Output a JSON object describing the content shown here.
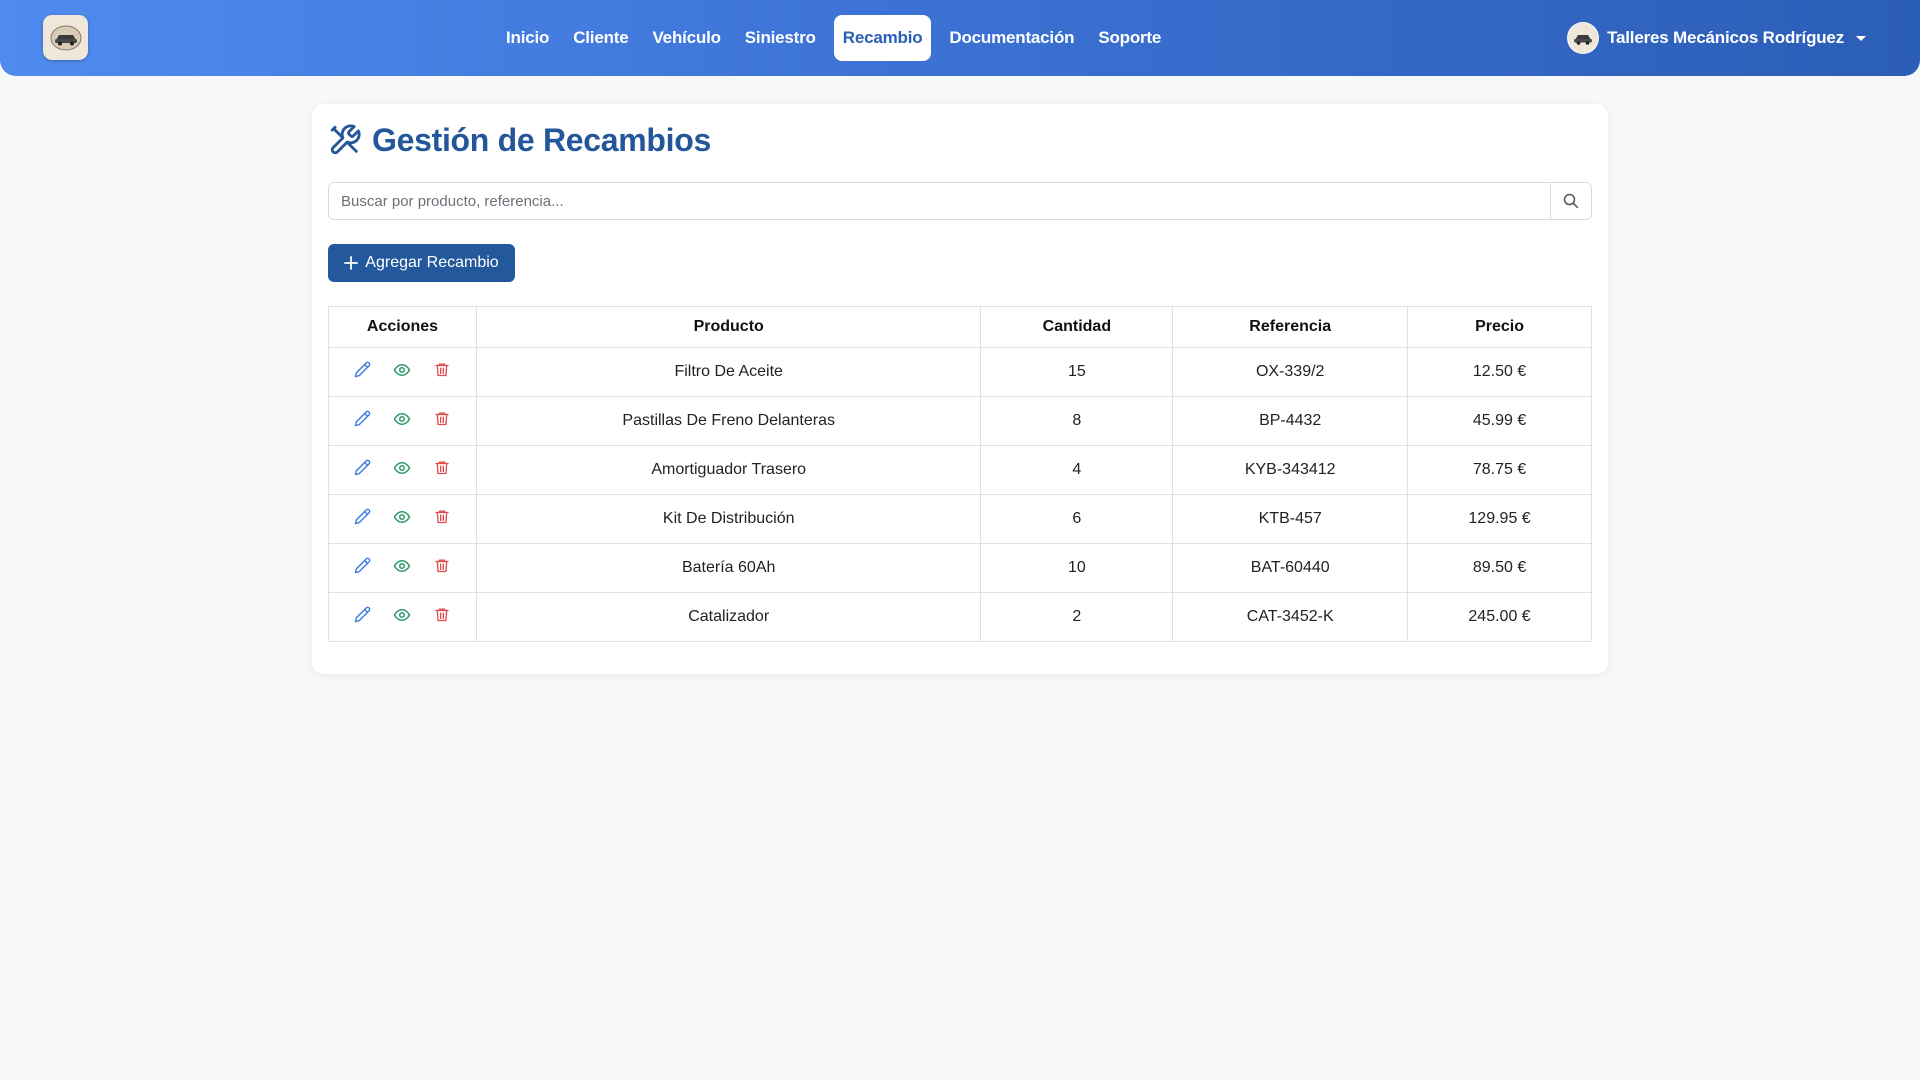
{
  "navbar": {
    "links": [
      {
        "label": "Inicio"
      },
      {
        "label": "Cliente"
      },
      {
        "label": "Vehículo"
      },
      {
        "label": "Siniestro"
      },
      {
        "label": "Recambio",
        "active": true
      },
      {
        "label": "Documentación"
      },
      {
        "label": "Soporte"
      }
    ],
    "user_name": "Talleres Mecánicos Rodríguez"
  },
  "page": {
    "title": "Gestión de Recambios",
    "search_placeholder": "Buscar por producto, referencia...",
    "add_button_label": "Agregar Recambio"
  },
  "table": {
    "headers": [
      "Acciones",
      "Producto",
      "Cantidad",
      "Referencia",
      "Precio"
    ],
    "rows": [
      {
        "producto": "Filtro De Aceite",
        "cantidad": "15",
        "referencia": "OX-339/2",
        "precio": "12.50 €"
      },
      {
        "producto": "Pastillas De Freno Delanteras",
        "cantidad": "8",
        "referencia": "BP-4432",
        "precio": "45.99 €"
      },
      {
        "producto": "Amortiguador Trasero",
        "cantidad": "4",
        "referencia": "KYB-343412",
        "precio": "78.75 €"
      },
      {
        "producto": "Kit De Distribución",
        "cantidad": "6",
        "referencia": "KTB-457",
        "precio": "129.95 €"
      },
      {
        "producto": "Batería 60Ah",
        "cantidad": "10",
        "referencia": "BAT-60440",
        "precio": "89.50 €"
      },
      {
        "producto": "Catalizador",
        "cantidad": "2",
        "referencia": "CAT-3452-K",
        "precio": "245.00 €"
      }
    ]
  },
  "colors": {
    "brand": "#24589c",
    "edit": "#3d7be0",
    "view": "#2f9a6b",
    "delete": "#e04b4b"
  },
  "icons": {
    "title": "tools-icon",
    "search": "search-icon",
    "add": "plus-icon",
    "edit": "pencil-icon",
    "view": "eye-icon",
    "delete": "trash-icon"
  }
}
